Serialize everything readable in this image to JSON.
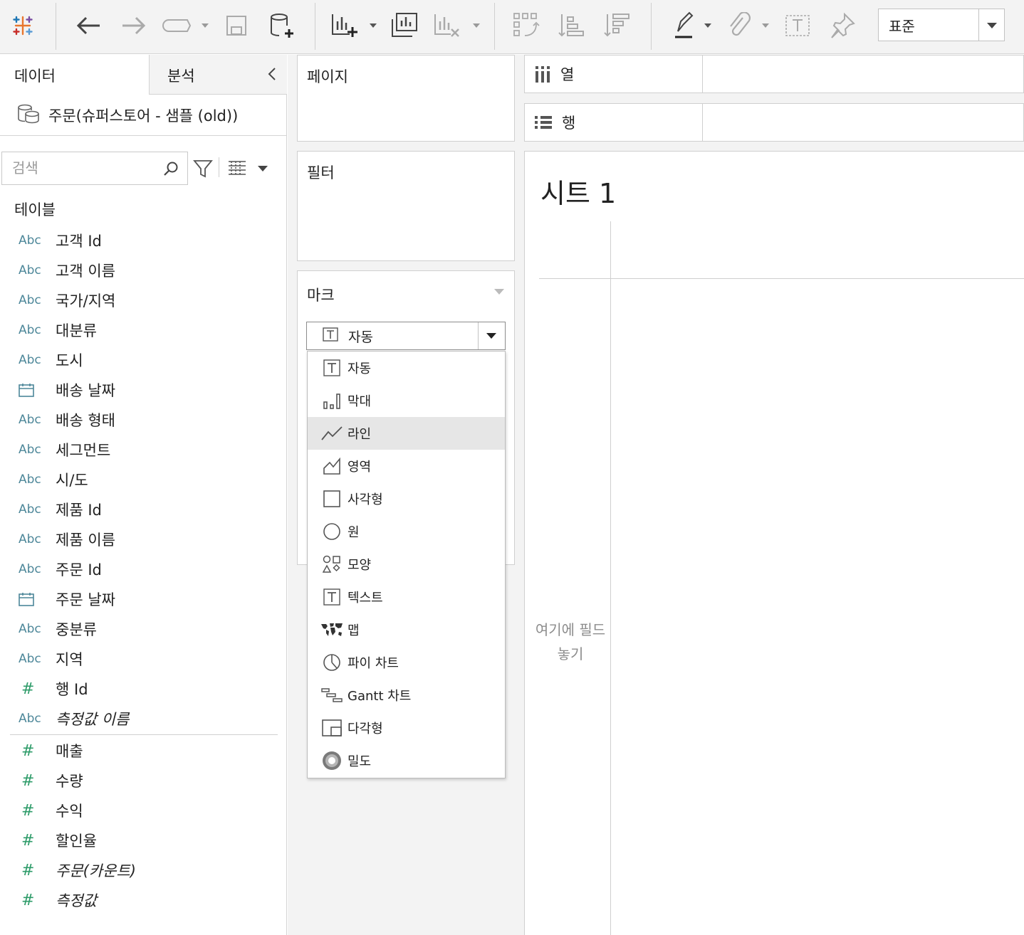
{
  "toolbar": {
    "icons": [
      "tableau-logo-icon",
      "undo-icon",
      "redo-icon",
      "replay-icon",
      "save-icon",
      "new-datasource-icon",
      "new-worksheet-icon",
      "duplicate-sheet-icon",
      "clear-sheet-icon",
      "swap-icon",
      "sort-ascending-icon",
      "sort-descending-icon",
      "highlight-icon",
      "group-icon",
      "label-icon",
      "pin-icon"
    ],
    "zoom_value": "표준"
  },
  "data_pane": {
    "tab_data": "데이터",
    "tab_analysis": "분석",
    "datasource_name": "주문(슈퍼스토어 - 샘플 (old))",
    "search_placeholder": "검색",
    "tables_header": "테이블",
    "dimensions": [
      {
        "type": "Abc",
        "name": "고객 Id"
      },
      {
        "type": "Abc",
        "name": "고객 이름"
      },
      {
        "type": "Abc",
        "name": "국가/지역"
      },
      {
        "type": "Abc",
        "name": "대분류"
      },
      {
        "type": "Abc",
        "name": "도시"
      },
      {
        "type": "date",
        "name": "배송 날짜"
      },
      {
        "type": "Abc",
        "name": "배송 형태"
      },
      {
        "type": "Abc",
        "name": "세그먼트"
      },
      {
        "type": "Abc",
        "name": "시/도"
      },
      {
        "type": "Abc",
        "name": "제품 Id"
      },
      {
        "type": "Abc",
        "name": "제품 이름"
      },
      {
        "type": "Abc",
        "name": "주문 Id"
      },
      {
        "type": "date",
        "name": "주문 날짜"
      },
      {
        "type": "Abc",
        "name": "중분류"
      },
      {
        "type": "Abc",
        "name": "지역"
      },
      {
        "type": "#",
        "name": "행 Id"
      },
      {
        "type": "Abc",
        "name": "측정값 이름",
        "italic": true
      }
    ],
    "measures": [
      {
        "type": "#",
        "name": "매출"
      },
      {
        "type": "#",
        "name": "수량"
      },
      {
        "type": "#",
        "name": "수익"
      },
      {
        "type": "#",
        "name": "할인율"
      },
      {
        "type": "#",
        "name": "주문(카운트)",
        "italic": true
      },
      {
        "type": "#",
        "name": "측정값",
        "italic": true
      }
    ]
  },
  "cards": {
    "pages": "페이지",
    "filters": "필터",
    "marks": "마크",
    "mark_type_selected": "자동"
  },
  "mark_menu": {
    "items": [
      {
        "icon": "text-icon",
        "label": "자동"
      },
      {
        "icon": "bar-icon",
        "label": "막대"
      },
      {
        "icon": "line-icon",
        "label": "라인",
        "highlighted": true
      },
      {
        "icon": "area-icon",
        "label": "영역"
      },
      {
        "icon": "square-icon",
        "label": "사각형"
      },
      {
        "icon": "circle-icon",
        "label": "원"
      },
      {
        "icon": "shape-icon",
        "label": "모양"
      },
      {
        "icon": "text-icon",
        "label": "텍스트"
      },
      {
        "icon": "map-icon",
        "label": "맵"
      },
      {
        "icon": "pie-icon",
        "label": "파이 차트"
      },
      {
        "icon": "gantt-icon",
        "label": "Gantt 차트"
      },
      {
        "icon": "polygon-icon",
        "label": "다각형"
      },
      {
        "icon": "density-icon",
        "label": "밀도"
      }
    ]
  },
  "shelves": {
    "columns": "열",
    "rows": "행"
  },
  "sheet": {
    "title": "시트 1",
    "drop_hint": "여기에 필드 놓기"
  },
  "colors": {
    "dimension_icon": "#4d8799",
    "measure_icon": "#2f9c6a",
    "toolbar_bg": "#f3f3f3",
    "menu_highlight": "#e6e6e6"
  }
}
